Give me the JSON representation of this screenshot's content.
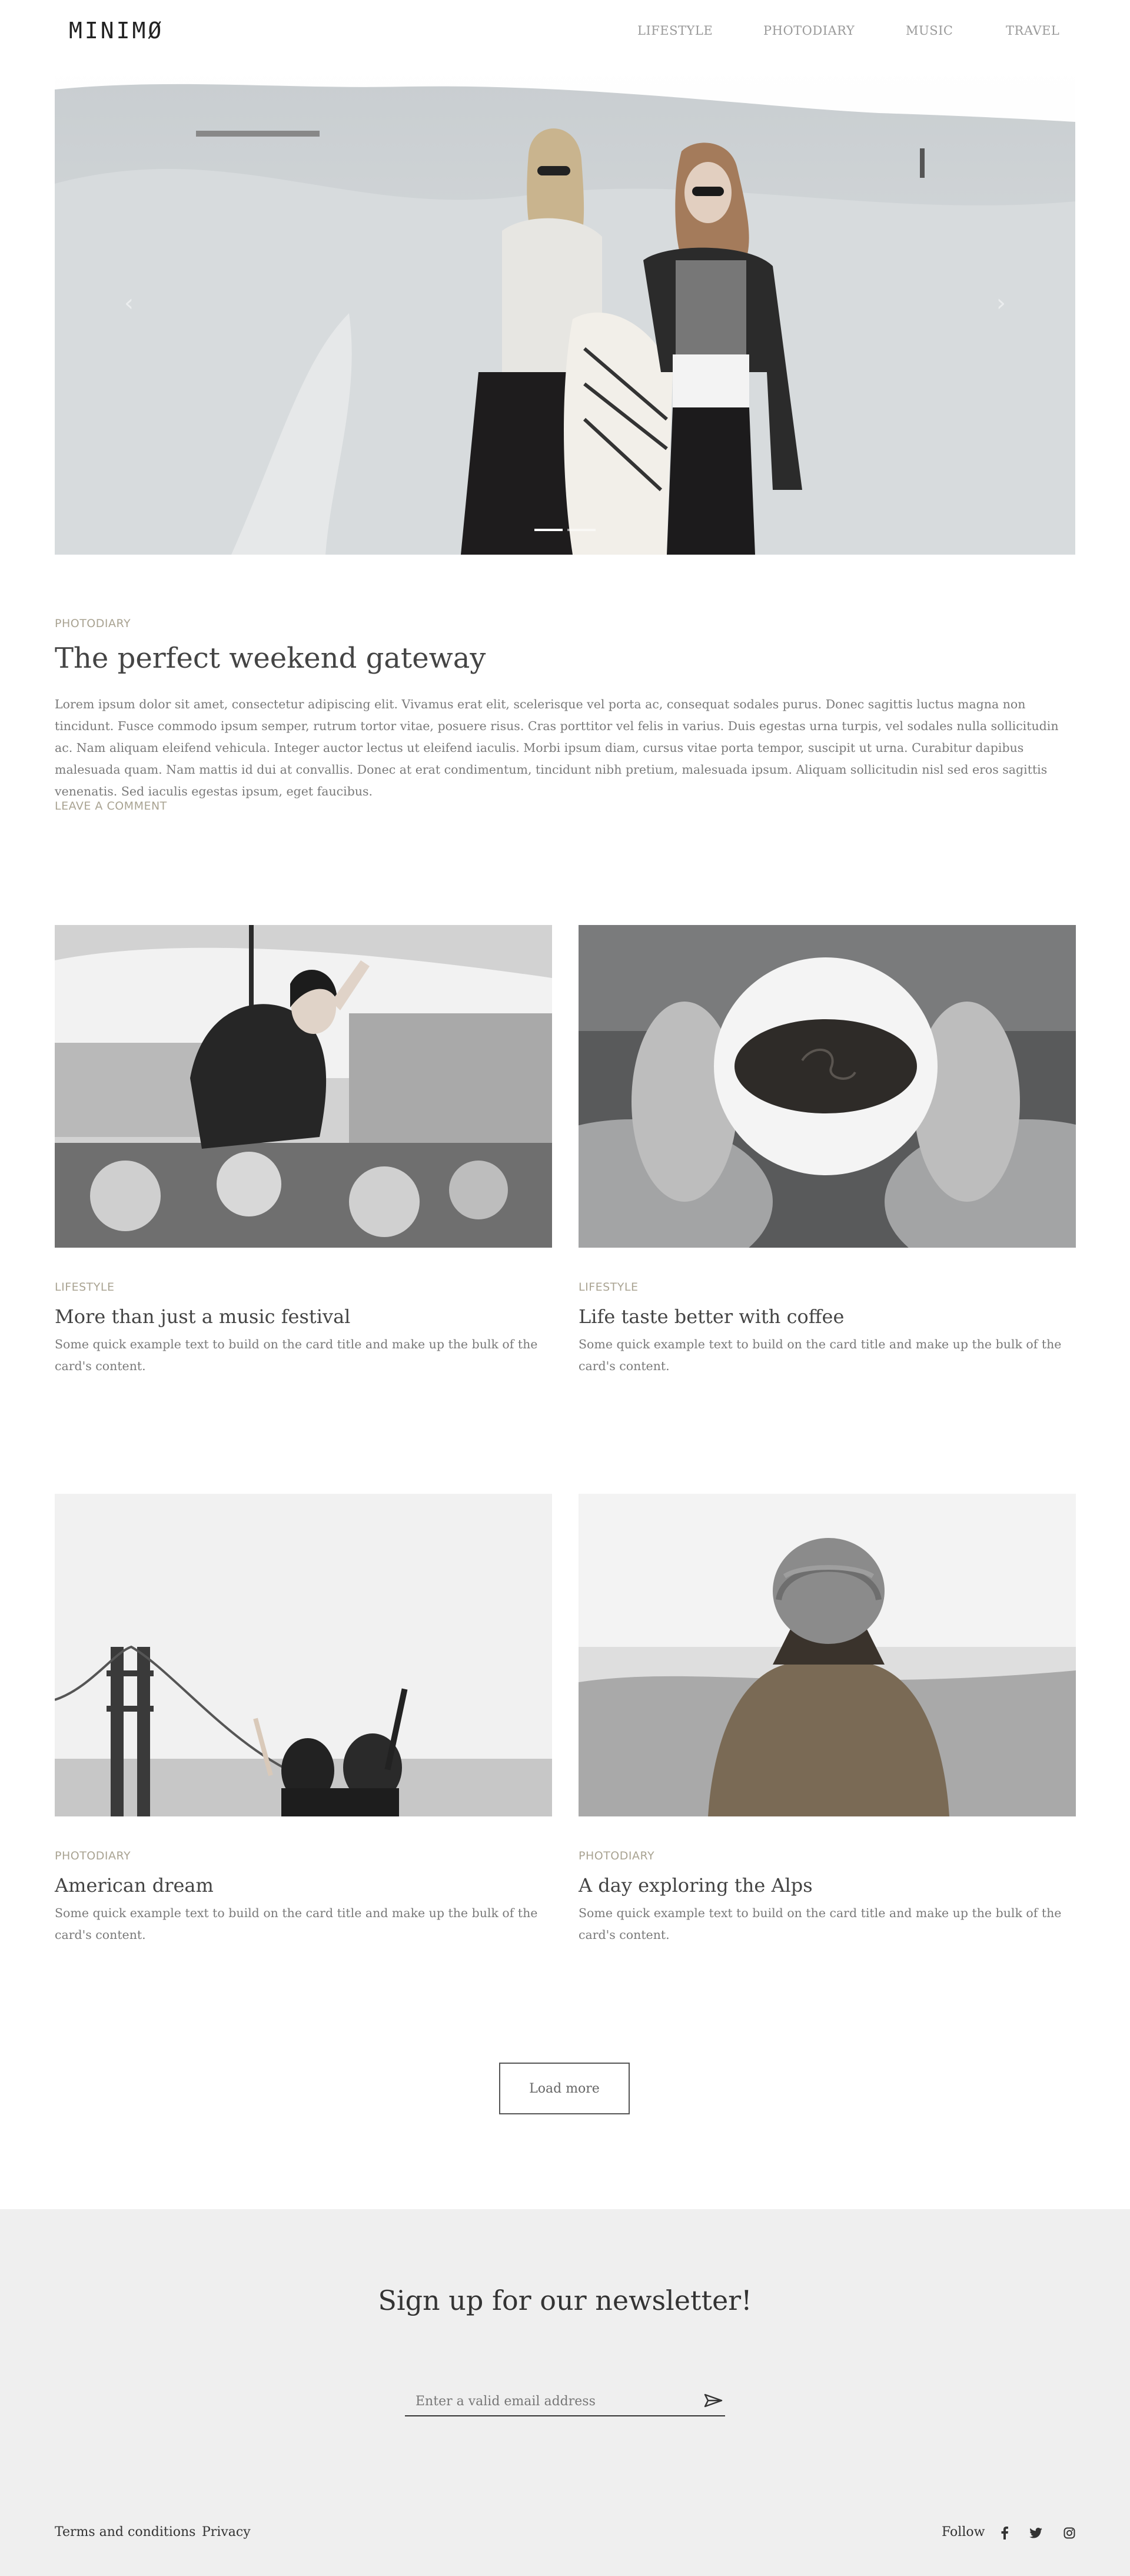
{
  "header": {
    "logo": "MINIMØ",
    "nav": [
      "LIFESTYLE",
      "PHOTODIARY",
      "MUSIC",
      "TRAVEL"
    ]
  },
  "hero": {
    "slides_total": 2,
    "active_slide": 1
  },
  "featured": {
    "category": "PHOTODIARY",
    "title": "The perfect weekend gateway",
    "body": "Lorem ipsum dolor sit amet, consectetur adipiscing elit. Vivamus erat elit, scelerisque vel porta ac, consequat sodales purus. Donec sagittis luctus magna non tincidunt. Fusce commodo ipsum semper, rutrum tortor vitae, posuere risus. Cras porttitor vel felis in varius. Duis egestas urna turpis, vel sodales nulla sollicitudin ac. Nam aliquam eleifend vehicula. Integer auctor lectus ut eleifend iaculis. Morbi ipsum diam, cursus vitae porta tempor, suscipit ut urna. Curabitur dapibus malesuada quam. Nam mattis id dui at convallis. Donec at erat condimentum, tincidunt nibh pretium, malesuada ipsum. Aliquam sollicitudin nisl sed eros sagittis venenatis. Sed iaculis egestas ipsum, eget faucibus.",
    "comment_link": "LEAVE A COMMENT"
  },
  "cards": [
    {
      "category": "LIFESTYLE",
      "title": "More than just a music festival",
      "text": "Some quick example text to build on the card title and make up the bulk of the card's content."
    },
    {
      "category": "LIFESTYLE",
      "title": "Life taste better with coffee",
      "text": "Some quick example text to build on the card title and make up the bulk of the card's content."
    },
    {
      "category": "PHOTODIARY",
      "title": "American dream",
      "text": "Some quick example text to build on the card title and make up the bulk of the card's content."
    },
    {
      "category": "PHOTODIARY",
      "title": "A day exploring the Alps",
      "text": "Some quick example text to build on the card title and make up the bulk of the card's content."
    }
  ],
  "load_more": "Load more",
  "newsletter": {
    "title": "Sign up for our newsletter!",
    "placeholder": "Enter a valid email address"
  },
  "footer": {
    "links": [
      "Terms and conditions",
      "Privacy"
    ],
    "follow": "Follow",
    "social": [
      "facebook-icon",
      "twitter-icon",
      "instagram-icon"
    ]
  },
  "colors": {
    "category": "#a9a392",
    "newsletter_bg": "#efefef",
    "text": "#7a7a7a"
  }
}
